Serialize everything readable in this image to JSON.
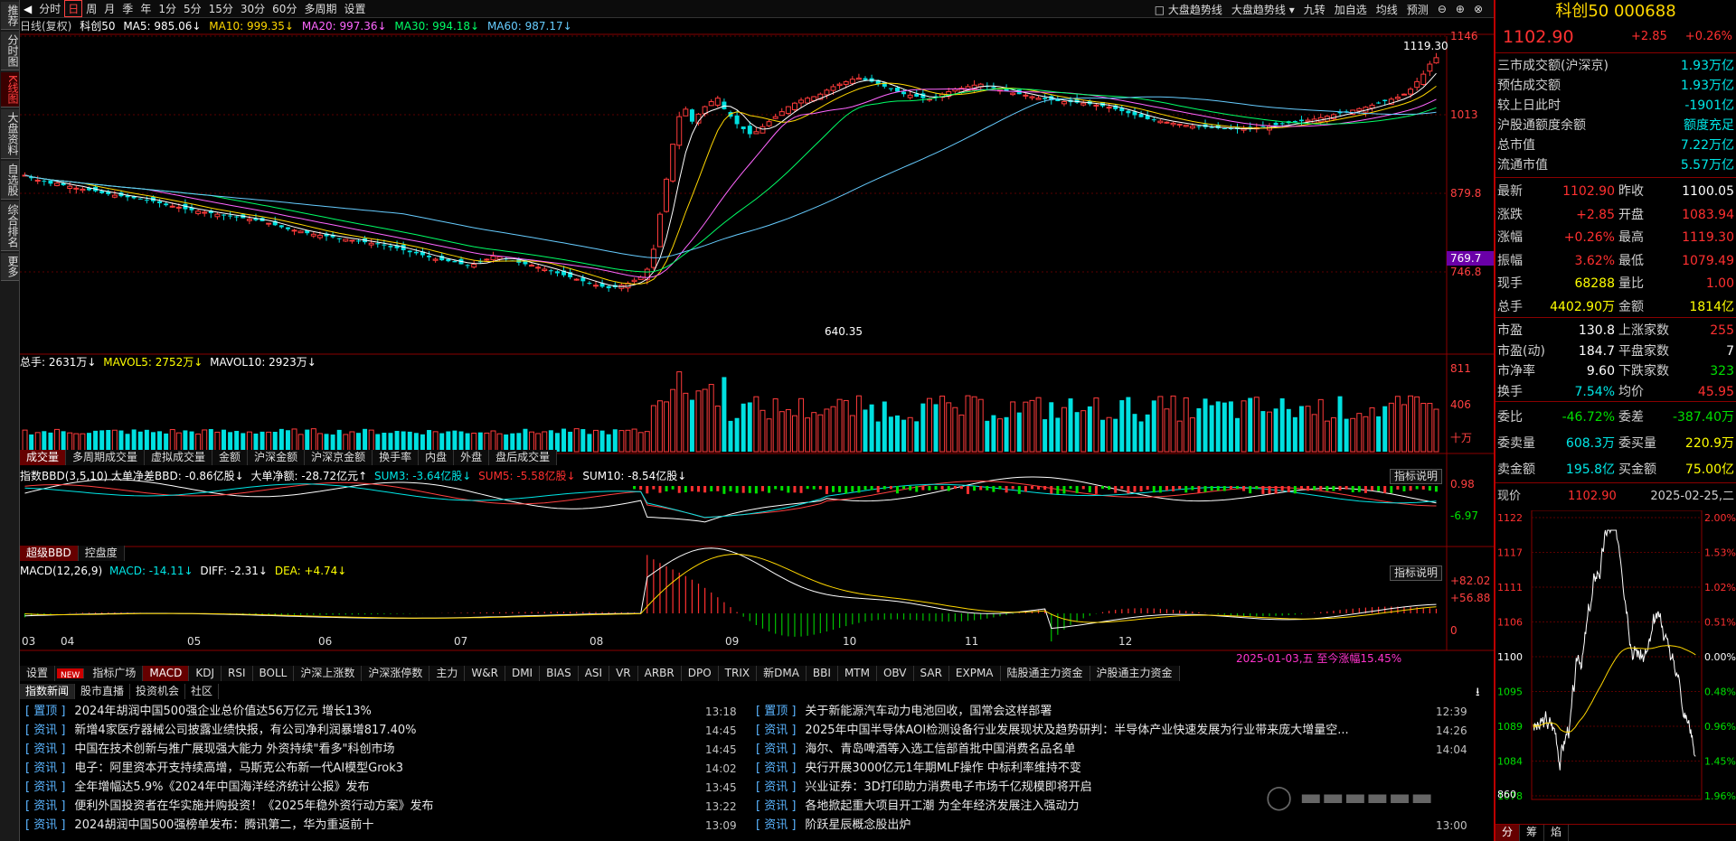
{
  "left_bar": [
    "推荐",
    "分时图",
    "K线图",
    "大盘资料",
    "自选股",
    "综合排名",
    "更多"
  ],
  "top_tabs": [
    "分时",
    "日",
    "周",
    "月",
    "季",
    "年",
    "1分",
    "5分",
    "15分",
    "30分",
    "60分",
    "多周期",
    "设置"
  ],
  "top_right": {
    "trend1": "大盘趋势线",
    "trend2": "大盘趋势线",
    "nine": "九转",
    "addself": "加自选",
    "ma": "均线",
    "forecast": "预测"
  },
  "ma_line": {
    "label": "日线(复权)",
    "name": "科创50",
    "ma5": "MA5: 985.06↓",
    "ma10": "MA10: 999.35↓",
    "ma20": "MA20: 997.36↓",
    "ma30": "MA30: 994.18↓",
    "ma60": "MA60: 987.17↓"
  },
  "price_axis": [
    "1146",
    "1013",
    "879.8",
    "746.8"
  ],
  "price_marker": "769.7",
  "high_label": "1119.30",
  "low_label": "640.35",
  "vol_line": {
    "total": "总手: 2631万↓",
    "mavol5": "MAVOL5: 2752万↓",
    "mavol10": "MAVOL10: 2923万↓"
  },
  "vol_axis": [
    "811",
    "406",
    "十万"
  ],
  "vol_tabs": [
    "成交量",
    "多周期成交量",
    "虚拟成交量",
    "金额",
    "沪深金额",
    "沪深京金额",
    "换手率",
    "内盘",
    "外盘",
    "盘后成交量"
  ],
  "bbd_line": {
    "a": "指数BBD(3,5,10) 大单净差BBD: -0.86亿股↓",
    "b": "大单净额: -28.72亿元↑",
    "c": "SUM3: -3.64亿股↓",
    "d": "SUM5: -5.58亿股↓",
    "e": "SUM10: -8.54亿股↓"
  },
  "bbd_axis": [
    "0.98",
    "-6.97"
  ],
  "explain": "指标说明",
  "bbd_tabs": [
    "超级BBD",
    "控盘度"
  ],
  "macd_line": {
    "a": "MACD(12,26,9)",
    "b": "MACD: -14.11↓",
    "c": "DIFF: -2.31↓",
    "d": "DEA: +4.74↓"
  },
  "macd_axis": [
    "+82.02",
    "+56.88",
    "0"
  ],
  "months": [
    "03",
    "04",
    "05",
    "06",
    "07",
    "08",
    "09",
    "10",
    "11",
    "12"
  ],
  "range_note": "2025-01-03,五 至今涨幅15.45%",
  "ind_tabs": [
    "设置",
    "NEW",
    "指标广场",
    "MACD",
    "KDJ",
    "RSI",
    "BOLL",
    "沪深上涨数",
    "沪深涨停数",
    "主力",
    "W&R",
    "DMI",
    "BIAS",
    "ASI",
    "VR",
    "ARBR",
    "DPO",
    "TRIX",
    "新DMA",
    "BBI",
    "MTM",
    "OBV",
    "SAR",
    "EXPMA",
    "陆股通主力资金",
    "沪股通主力资金"
  ],
  "news_tabs": [
    "指数新闻",
    "股市直播",
    "投资机会",
    "社区"
  ],
  "news_left": [
    {
      "tag": "[ 置顶 ]",
      "title": "2024年胡润中国500强企业总价值达56万亿元 增长13%",
      "time": "13:18"
    },
    {
      "tag": "[ 资讯 ]",
      "title": "新增4家医疗器械公司披露业绩快报，有公司净利润暴增817.40%",
      "time": "14:45"
    },
    {
      "tag": "[ 资讯 ]",
      "title": "中国在技术创新与推广展现强大能力 外资持续\"看多\"科创市场",
      "time": "14:45"
    },
    {
      "tag": "[ 资讯 ]",
      "title": "电子：阿里资本开支持续高增，马斯克公布新一代AI模型Grok3",
      "time": "14:02"
    },
    {
      "tag": "[ 资讯 ]",
      "title": "全年增幅达5.9%《2024年中国海洋经济统计公报》发布",
      "time": "13:45"
    },
    {
      "tag": "[ 资讯 ]",
      "title": "便利外国投资者在华实施并购投资！《2025年稳外资行动方案》发布",
      "time": "13:22"
    },
    {
      "tag": "[ 资讯 ]",
      "title": "2024胡润中国500强榜单发布：腾讯第二，华为重返前十",
      "time": "13:09"
    }
  ],
  "news_right": [
    {
      "tag": "[ 置顶 ]",
      "title": "关于新能源汽车动力电池回收，国常会这样部署",
      "time": "12:39"
    },
    {
      "tag": "[ 资讯 ]",
      "title": "2025年中国半导体AOI检测设备行业发展现状及趋势研判：半导体产业快速发展为行业带来庞大增量空...",
      "time": "14:26"
    },
    {
      "tag": "[ 资讯 ]",
      "title": "海尔、青岛啤酒等入选工信部首批中国消费名品名单",
      "time": "14:04"
    },
    {
      "tag": "[ 资讯 ]",
      "title": "央行开展3000亿元1年期MLF操作 中标利率维持不变",
      "time": ""
    },
    {
      "tag": "[ 资讯 ]",
      "title": "兴业证券：3D打印助力消费电子市场千亿规模即将开启",
      "time": ""
    },
    {
      "tag": "[ 资讯 ]",
      "title": "各地掀起重大项目开工潮 为全年经济发展注入强动力",
      "time": ""
    },
    {
      "tag": "[ 资讯 ]",
      "title": "阶跃星辰概念股出炉",
      "time": "13:00"
    }
  ],
  "rp": {
    "title": "科创50 000688",
    "price": "1102.90",
    "chg": "+2.85",
    "pct": "+0.26%",
    "turnover_rows": [
      [
        "三市成交额(沪深京)",
        "1.93万亿"
      ],
      [
        "预估成交额",
        "1.93万亿"
      ],
      [
        "较上日此时",
        "-1901亿"
      ],
      [
        "沪股通额度余额",
        "额度充足"
      ],
      [
        "总市值",
        "7.22万亿"
      ],
      [
        "流通市值",
        "5.57万亿"
      ]
    ],
    "quote_rows": [
      [
        "最新",
        "1102.90",
        "昨收",
        "1100.05"
      ],
      [
        "涨跌",
        "+2.85",
        "开盘",
        "1083.94"
      ],
      [
        "涨幅",
        "+0.26%",
        "最高",
        "1119.30"
      ],
      [
        "振幅",
        "3.62%",
        "最低",
        "1079.49"
      ],
      [
        "现手",
        "68288",
        "量比",
        "1.00"
      ],
      [
        "总手",
        "4402.90万",
        "金额",
        "1814亿"
      ]
    ],
    "stat_rows": [
      [
        "市盈",
        "130.8",
        "上涨家数",
        "255"
      ],
      [
        "市盈(动)",
        "184.7",
        "平盘家数",
        "7"
      ],
      [
        "市净率",
        "9.60",
        "下跌家数",
        "323"
      ],
      [
        "换手",
        "7.54%",
        "均价",
        "45.95"
      ]
    ],
    "order_rows": [
      [
        "委比",
        "-46.72%",
        "委差",
        "-387.40万"
      ],
      [
        "委卖量",
        "608.3万",
        "委买量",
        "220.9万"
      ],
      [
        "卖金额",
        "195.8亿",
        "买金额",
        "75.00亿"
      ]
    ],
    "now_label": "现价",
    "now_price": "1102.90",
    "date": "2025-02-25,二",
    "mini_left": [
      "1122",
      "1117",
      "1111",
      "1106",
      "1100",
      "1095",
      "1089",
      "1084",
      "1078",
      "860"
    ],
    "mini_right": [
      "2.00%",
      "1.53%",
      "1.02%",
      "0.51%",
      "0.00%",
      "0.48%",
      "0.96%",
      "1.45%",
      "1.96%"
    ],
    "bottom_tabs": [
      "分",
      "筹",
      "焰"
    ]
  },
  "chart_data": {
    "type": "candlestick",
    "title": "科创50",
    "period": "日线(复权)",
    "x_months": [
      "03",
      "04",
      "05",
      "06",
      "07",
      "08",
      "09",
      "10",
      "11",
      "12"
    ],
    "price_range": [
      640.35,
      1146
    ],
    "high": 1119.3,
    "low": 640.35,
    "close": [
      868,
      862,
      858,
      855,
      851,
      852,
      848,
      846,
      842,
      840,
      838,
      836,
      832,
      830,
      828,
      826,
      824,
      822,
      820,
      818,
      816,
      812,
      808,
      806,
      804,
      800,
      798,
      796,
      794,
      792,
      790,
      788,
      786,
      784,
      782,
      780,
      778,
      776,
      772,
      768,
      764,
      760,
      758,
      756,
      752,
      750,
      748,
      746,
      744,
      742,
      740,
      738,
      736,
      734,
      732,
      730,
      728,
      724,
      722,
      718,
      714,
      712,
      708,
      704,
      700,
      698,
      696,
      694,
      690,
      688,
      690,
      695,
      700,
      706,
      705,
      700,
      696,
      693,
      690,
      688,
      684,
      680,
      676,
      672,
      668,
      664,
      660,
      656,
      652,
      648,
      645,
      642,
      644,
      648,
      652,
      658,
      664,
      680,
      720,
      790,
      860,
      930,
      985,
      1000,
      975,
      990,
      1005,
      1015,
      1022,
      1000,
      985,
      970,
      960,
      950,
      955,
      965,
      975,
      985,
      995,
      1005,
      1012,
      1018,
      1022,
      1025,
      1030,
      1038,
      1045,
      1050,
      1055,
      1060,
      1062,
      1058,
      1055,
      1050,
      1045,
      1040,
      1035,
      1030,
      1028,
      1025,
      1022,
      1020,
      1025,
      1030,
      1035,
      1040,
      1042,
      1045,
      1048,
      1050,
      1046,
      1042,
      1038,
      1036,
      1032,
      1030,
      1028,
      1025,
      1022,
      1020,
      1018,
      1016,
      1015,
      1014,
      1013,
      1012,
      1010,
      1008,
      1006,
      1004,
      1000,
      996,
      992,
      988,
      984,
      980,
      978,
      976,
      974,
      972,
      970,
      968,
      966,
      965,
      964,
      963,
      962,
      961,
      960,
      960,
      961,
      962,
      963,
      964,
      966,
      968,
      970,
      972,
      974,
      976,
      978,
      980,
      983,
      986,
      989,
      992,
      995,
      998,
      1001,
      1004,
      1008,
      1012,
      1016,
      1020,
      1024,
      1030,
      1040,
      1055,
      1070,
      1090,
      1102.9
    ],
    "volume_range": [
      0,
      811
    ],
    "macd_range": [
      -40,
      82.02
    ]
  }
}
